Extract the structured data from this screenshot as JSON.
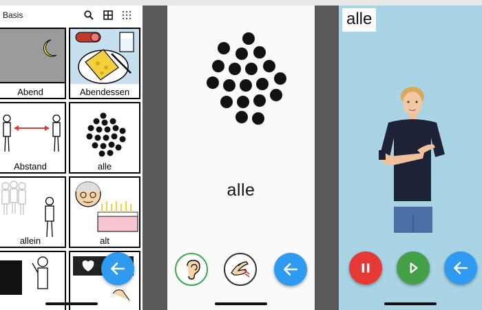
{
  "screen1": {
    "title": "Basis",
    "header_icons": [
      "search-icon",
      "grid-icon",
      "dots-grid-icon"
    ],
    "cells": [
      {
        "label": "Abend",
        "symbol": "moon-night-symbol"
      },
      {
        "label": "Abendessen",
        "symbol": "dinner-plate-symbol"
      },
      {
        "label": "Abstand",
        "symbol": "distance-people-symbol"
      },
      {
        "label": "alle",
        "symbol": "dot-cluster-symbol"
      },
      {
        "label": "allein",
        "symbol": "alone-person-symbol"
      },
      {
        "label": "alt",
        "symbol": "old-man-cake-symbol"
      },
      {
        "label": "",
        "symbol": "person-thinking-symbol"
      },
      {
        "label": "",
        "symbol": "apple-keyboard-symbol"
      }
    ],
    "back_button_icon": "arrow-left-icon"
  },
  "screen2": {
    "word": "alle",
    "buttons": [
      "ear-icon",
      "signing-hands-icon",
      "arrow-left-icon"
    ]
  },
  "screen3": {
    "word": "alle",
    "controls": [
      "pause-icon",
      "play-icon",
      "arrow-left-icon"
    ]
  },
  "colors": {
    "fab_blue": "#2e9bf0",
    "pause_red": "#e53935",
    "play_green": "#43a047",
    "screen3_bg": "#a9d4e4",
    "ear_ring_green": "#3aa94a"
  }
}
